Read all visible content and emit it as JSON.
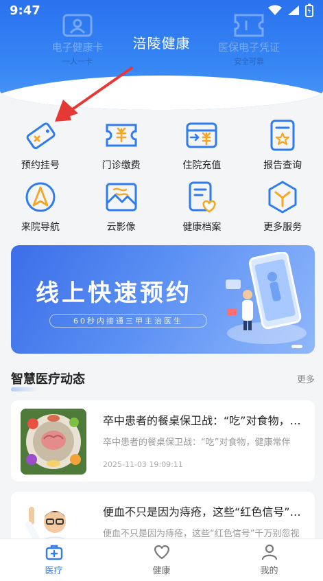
{
  "status_bar": {
    "time": "9:47"
  },
  "header": {
    "title": "涪陵健康",
    "left_card": {
      "title": "电子健康卡",
      "subtitle": "一人一卡"
    },
    "right_card": {
      "title": "医保电子凭证",
      "subtitle": "安全可靠"
    }
  },
  "quick_actions": [
    {
      "label": "预约挂号",
      "icon": "ticket-tag-icon"
    },
    {
      "label": "门诊缴费",
      "icon": "payment-ticket-icon"
    },
    {
      "label": "住院充值",
      "icon": "wallet-recharge-icon"
    },
    {
      "label": "报告查询",
      "icon": "report-clipboard-icon"
    },
    {
      "label": "来院导航",
      "icon": "navigation-arrow-icon"
    },
    {
      "label": "云影像",
      "icon": "cloud-image-icon"
    },
    {
      "label": "健康档案",
      "icon": "health-record-icon"
    },
    {
      "label": "更多服务",
      "icon": "more-services-icon"
    }
  ],
  "banner": {
    "title": "线上快速预约",
    "subtitle": "60秒内接通三甲主治医生"
  },
  "news_section": {
    "title": "智慧医疗动态",
    "more": "更多",
    "items": [
      {
        "title": "卒中患者的餐桌保卫战：“吃”对食物，健康常伴",
        "desc": "卒中患者的餐桌保卫战：“吃”对食物，健康常伴",
        "date": "2025-11-03 19:09:11"
      },
      {
        "title": "便血不只是因为痔疮，这些“红色信号”千万别忽视",
        "desc": "便血不只是因为痔疮，这些“红色信号”千万别忽视",
        "date": ""
      }
    ]
  },
  "bottom_nav": [
    {
      "label": "医疗",
      "active": true
    },
    {
      "label": "健康",
      "active": false
    },
    {
      "label": "我的",
      "active": false
    }
  ],
  "colors": {
    "primary": "#2f7bf0",
    "accent_orange": "#f5a623",
    "header_blue": "#3686f4",
    "annotation_red": "#e53935"
  }
}
